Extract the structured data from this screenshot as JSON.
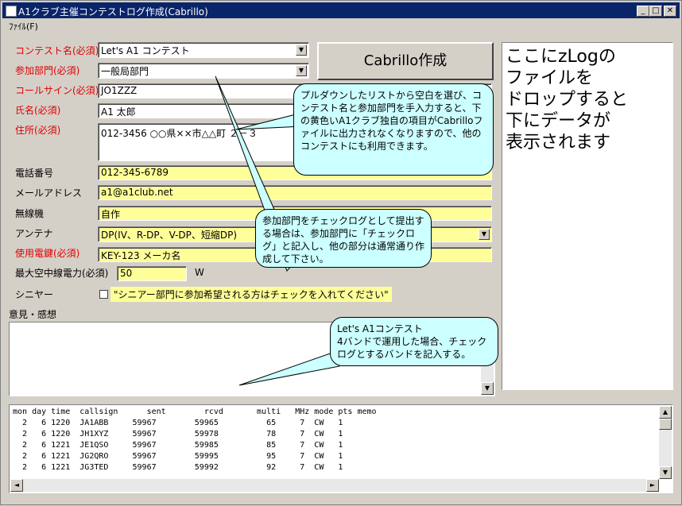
{
  "window": {
    "title": "A1クラブ主催コンテストログ作成(Cabrillo)"
  },
  "menu": {
    "file": "ﾌｧｲﾙ(F)"
  },
  "form": {
    "contest": {
      "label": "コンテスト名(必須)",
      "value": "Let's A1 コンテスト"
    },
    "category": {
      "label": "参加部門(必須)",
      "value": "一般局部門"
    },
    "callsign": {
      "label": "コールサイン(必須)",
      "value": "JO1ZZZ"
    },
    "name": {
      "label": "氏名(必須)",
      "value": "A1 太郎"
    },
    "address": {
      "label": "住所(必須)",
      "value": "012-3456 ○○県××市△△町 ２－３"
    },
    "phone": {
      "label": "電話番号",
      "value": "012-345-6789"
    },
    "email": {
      "label": "メールアドレス",
      "value": "a1@a1club.net"
    },
    "rig": {
      "label": "無線機",
      "value": "自作"
    },
    "antenna": {
      "label": "アンテナ",
      "value": "DP(IV、R-DP、V-DP、短縮DP)"
    },
    "key": {
      "label": "使用電鍵(必須)",
      "value": "KEY-123 メーカ名"
    },
    "power": {
      "label": "最大空中線電力(必須)",
      "value": "50",
      "unit": "W"
    },
    "senior": {
      "label": "シニヤー",
      "checkbox_label": "\"シニアー部門に参加希望される方はチェックを入れてください\""
    },
    "comment": {
      "label": "意見・感想",
      "value": ""
    }
  },
  "cabrillo_button": "Cabrillo作成",
  "dropzone": "ここにzLogの\nファイルを\nドロップすると\n下にデータが\n表示されます",
  "callouts": {
    "c1": "プルダウンしたリストから空白を選び、コンテスト名と参加部門を手入力すると、下の黄色いA1クラブ独自の項目がCabrilloファイルに出力されなくなりますので、他のコンテストにも利用できます。",
    "c2": "参加部門をチェックログとして提出する場合は、参加部門に「チェックログ」と記入し、他の部分は通常通り作成して下さい。",
    "c3": "Let's A1コンテスト\n4バンドで運用した場合、チェックログとするバンドを記入する。"
  },
  "log": {
    "header": "mon day time  callsign      sent        rcvd       multi   MHz mode pts memo",
    "rows": [
      "  2   6 1220  JA1ABB     59967        59965          65     7  CW   1",
      "  2   6 1220  JH1XYZ     59967        59978          78     7  CW   1",
      "  2   6 1221  JE1QSO     59967        59985          85     7  CW   1",
      "  2   6 1221  JG2QRO     59967        59995          95     7  CW   1",
      "  2   6 1221  JG3TED     59967        59992          92     7  CW   1"
    ]
  }
}
